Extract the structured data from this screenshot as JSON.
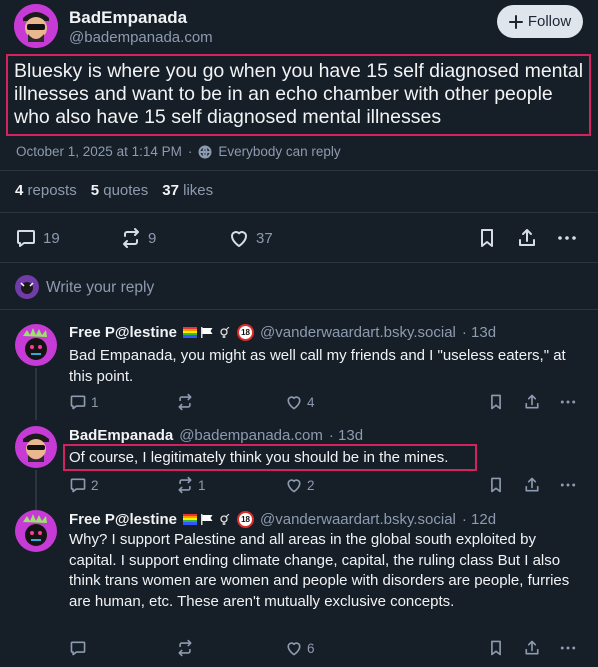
{
  "post": {
    "author_name": "BadEmpanada",
    "author_handle": "@badempanada.com",
    "follow_label": "Follow",
    "text": "Bluesky is where you go when you have 15 self diagnosed mental illnesses and want to be in an echo chamber with other people who also have 15 self diagnosed mental illnesses",
    "timestamp": "October 1, 2025 at 1:14 PM",
    "reply_setting": "Everybody can reply",
    "stats": {
      "reposts_count": "4",
      "reposts_label": "reposts",
      "quotes_count": "5",
      "quotes_label": "quotes",
      "likes_count": "37",
      "likes_label": "likes"
    },
    "actions": {
      "replies": "19",
      "reposts": "9",
      "likes": "37"
    }
  },
  "reply_box": {
    "placeholder": "Write your reply"
  },
  "replies": [
    {
      "author_name": "Free P@lestine",
      "badge_18": "18",
      "author_handle": "@vanderwaardart.bsky.social",
      "time": "· 13d",
      "text": "Bad Empanada, you might as well call my friends and I \"useless eaters,\" at this point.",
      "replies": "1",
      "likes": "4"
    },
    {
      "author_name": "BadEmpanada",
      "author_handle": "@badempanada.com",
      "time": "· 13d",
      "text": "Of course, I legitimately think you should be in the mines.",
      "replies": "2",
      "reposts": "1",
      "likes": "2"
    },
    {
      "author_name": "Free P@lestine",
      "badge_18": "18",
      "author_handle": "@vanderwaardart.bsky.social",
      "time": "· 12d",
      "text": "Why? I support Palestine and all areas in the global south exploited by capital. I support ending climate change, capital, the ruling class But I also think trans women are women and people with disorders are people, furries are human, etc. These aren't mutually exclusive concepts.",
      "likes": "6"
    }
  ],
  "colors": {
    "background": "#161e27",
    "highlight": "#d4225f",
    "muted": "#8d9bb0",
    "avatar_pink": "#c63bd6"
  }
}
